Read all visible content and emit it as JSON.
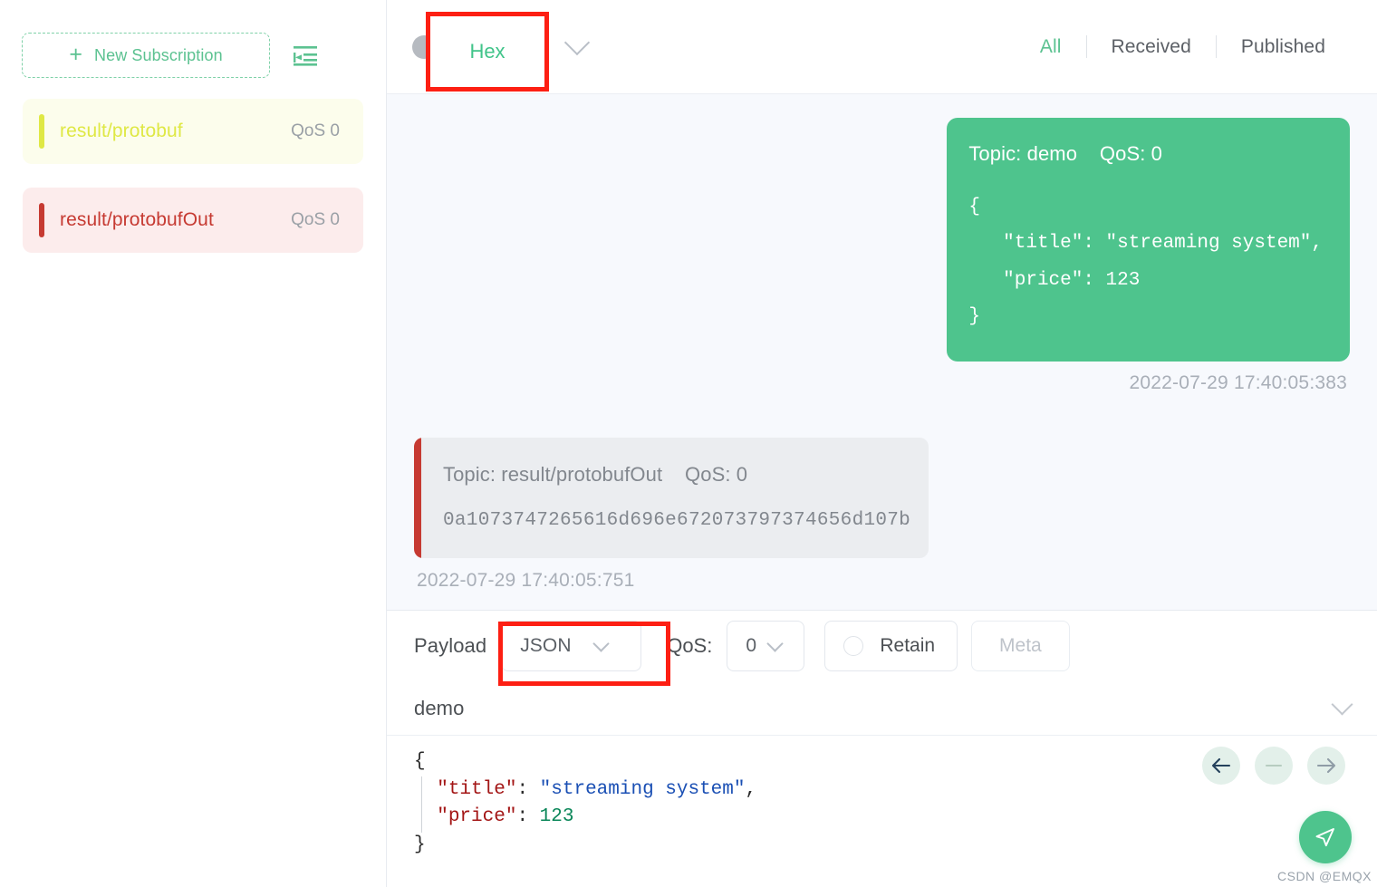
{
  "sidebar": {
    "new_subscription_label": "New Subscription",
    "plus_icon": "plus-icon",
    "collapse_icon": "collapse-panel-icon",
    "subscriptions": [
      {
        "topic": "result/protobuf",
        "qos": "QoS 0",
        "color": "#dfe845",
        "bg": "#fcfdec"
      },
      {
        "topic": "result/protobufOut",
        "qos": "QoS 0",
        "color": "#c63a32",
        "bg": "#fcecec"
      }
    ]
  },
  "header": {
    "status_dot": "connection-status-dot",
    "format": "Hex",
    "format_chevron": "chevron-down-icon",
    "filters": [
      {
        "label": "All",
        "active": true
      },
      {
        "label": "Received",
        "active": false
      },
      {
        "label": "Published",
        "active": false
      }
    ]
  },
  "messages": [
    {
      "direction": "published",
      "meta": "Topic: demo    QoS: 0",
      "payload": "{\n   \"title\": \"streaming system\",\n   \"price\": 123\n}",
      "timestamp": "2022-07-29 17:40:05:383",
      "accent": "#4ec48d"
    },
    {
      "direction": "received",
      "meta": "Topic: result/protobufOut    QoS: 0",
      "payload": "0a1073747265616d696e672073797374656d107b",
      "timestamp": "2022-07-29 17:40:05:751",
      "accent": "#c63a32"
    }
  ],
  "publish": {
    "payload_label": "Payload",
    "payload_format": "JSON",
    "qos_label": "QoS:",
    "qos_value": "0",
    "retain_label": "Retain",
    "retain_checked": false,
    "meta_label": "Meta",
    "topic_value": "demo",
    "topic_chevron": "chevron-down-icon",
    "editor": {
      "line1_brace": "{",
      "line2_key": "\"title\"",
      "line2_colon": ": ",
      "line2_str": "\"streaming system\"",
      "line2_comma": ",",
      "line3_key": "\"price\"",
      "line3_colon": ": ",
      "line3_num": "123",
      "line4_brace": "}"
    },
    "actions": [
      {
        "icon": "arrow-left-icon",
        "state": "enabled"
      },
      {
        "icon": "minus-icon",
        "state": "disabled"
      },
      {
        "icon": "arrow-right-icon",
        "state": "enabled"
      }
    ],
    "send_icon": "send-paper-plane-icon"
  },
  "annotations": [
    {
      "name": "hex-format-highlight",
      "target": "Hex"
    },
    {
      "name": "json-payload-highlight",
      "target": "JSON"
    }
  ],
  "watermark": "CSDN @EMQX"
}
